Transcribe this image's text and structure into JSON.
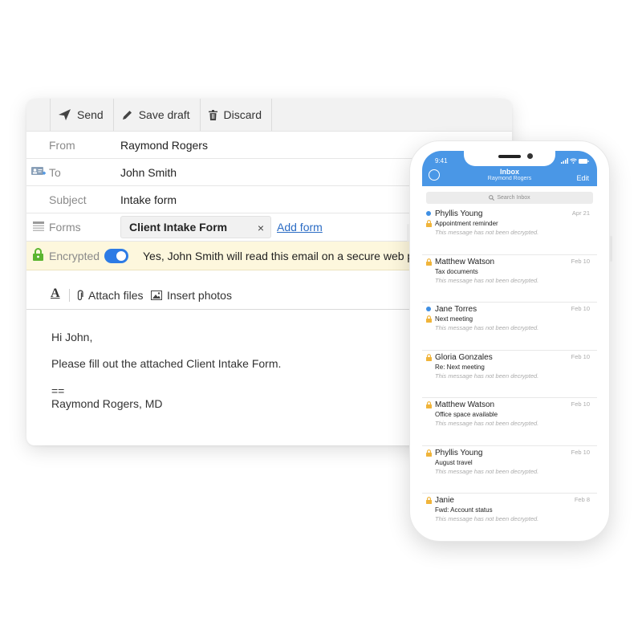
{
  "compose": {
    "toolbar": {
      "send": "Send",
      "save_draft": "Save draft",
      "discard": "Discard"
    },
    "from": {
      "label": "From",
      "value": "Raymond Rogers"
    },
    "to": {
      "label": "To",
      "value": "John Smith"
    },
    "subject": {
      "label": "Subject",
      "value": "Intake form"
    },
    "forms": {
      "label": "Forms",
      "chip": "Client Intake Form",
      "remove": "×",
      "add": "Add form"
    },
    "encrypted": {
      "label": "Encrypted",
      "message": "Yes, John Smith will read this email on a secure web pa",
      "on": true
    },
    "format_bar": {
      "font": "A",
      "attach": "Attach files",
      "insert": "Insert photos"
    },
    "body": {
      "greeting": "Hi John,",
      "line1": "Please fill out the attached Client Intake Form.",
      "sep": "==",
      "signature": "Raymond Rogers, MD"
    },
    "colors": {
      "accent": "#2d7be5",
      "encrypted_bg": "#fdf7dd",
      "lock": "#5bb531"
    }
  },
  "phone": {
    "time": "9:41",
    "title": "Inbox",
    "subtitle": "Raymond Rogers",
    "edit": "Edit",
    "search_placeholder": "Search Inbox",
    "colors": {
      "header": "#4a97e6",
      "unread_dot": "#3f8fe3",
      "lock": "#f0b43a"
    },
    "messages": [
      {
        "name": "Phyllis Young",
        "subject": "Appointment reminder",
        "preview": "This message has not been decrypted.",
        "date": "Apr 21",
        "unread": true
      },
      {
        "name": "Matthew Watson",
        "subject": "Tax documents",
        "preview": "This message has not been decrypted.",
        "date": "Feb 10",
        "unread": false
      },
      {
        "name": "Jane Torres",
        "subject": "Next meeting",
        "preview": "This message has not been decrypted.",
        "date": "Feb 10",
        "unread": true
      },
      {
        "name": "Gloria Gonzales",
        "subject": "Re: Next meeting",
        "preview": "This message has not been decrypted.",
        "date": "Feb 10",
        "unread": false
      },
      {
        "name": "Matthew Watson",
        "subject": "Office space available",
        "preview": "This message has not been decrypted.",
        "date": "Feb 10",
        "unread": false
      },
      {
        "name": "Phyllis Young",
        "subject": "August travel",
        "preview": "This message has not been decrypted.",
        "date": "Feb 10",
        "unread": false
      },
      {
        "name": "Janie",
        "subject": "Fwd: Account status",
        "preview": "This message has not been decrypted.",
        "date": "Feb 8",
        "unread": false
      }
    ]
  }
}
